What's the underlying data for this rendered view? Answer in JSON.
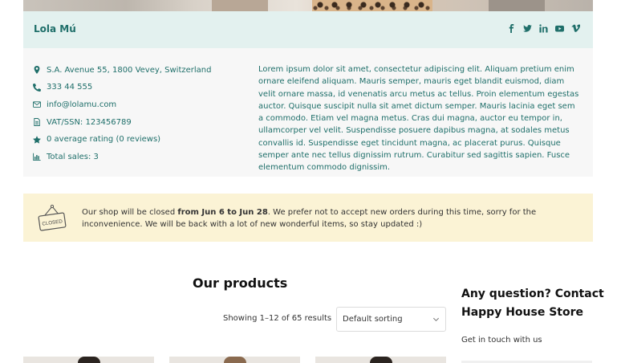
{
  "vendor": {
    "name": "Lola Mú",
    "socials": [
      "facebook-icon",
      "twitter-icon",
      "linkedin-icon",
      "youtube-icon",
      "vimeo-icon"
    ],
    "details": {
      "address": "S.A. Avenue 55, 1800 Vevey, Switzerland",
      "phone": "333 44 555",
      "email": "info@lolamu.com",
      "vat": "VAT/SSN: 123456789",
      "rating": "0 average rating (0 reviews)",
      "sales": "Total sales: 3"
    },
    "about": "Lorem ipsum dolor sit amet, consectetur adipiscing elit. Aliquam pretium enim ornare eleifend aliquam. Mauris semper, mauris eget blandit euismod, diam velit ornare massa, id venenatis arcu metus ac tellus. Proin elementum egestas auctor. Quisque suscipit nulla sit amet dictum semper. Mauris lacinia eget sem a commodo. Etiam vel magna metus. Cras dui magna, auctor eu tempor in, ullamcorper vel velit. Suspendisse posuere dapibus magna, at sodales metus convallis id. Suspendisse eget tincidunt magna, ac placerat purus. Quisque semper ante nec tellus dignissim rutrum. Curabitur sed sagittis sapien. Fusce elementum commodo dignissim."
  },
  "notice": {
    "sign_label": "CLOSED",
    "text_before": "Our shop will be closed ",
    "text_bold": "from Jun 6 to Jun 28",
    "text_after": ". We prefer not to accept new orders during this time, sorry for the inconvenience. We will be back with a lot of new wonderful items, so stay updated :)"
  },
  "products": {
    "title": "Our products",
    "results": "Showing 1–12 of 65 results",
    "sort_selected": "Default sorting"
  },
  "sidebar": {
    "title": "Any question? Contact Happy House Store",
    "subtitle": "Get in touch with us"
  },
  "colors": {
    "accent": "#1f6f6a",
    "header_bg": "#e3f1ef",
    "panel_bg": "#f7f7f7",
    "notice_bg": "#fbf3d5"
  }
}
